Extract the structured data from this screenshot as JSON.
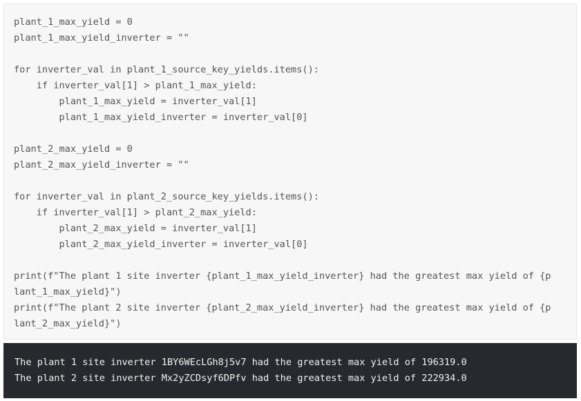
{
  "code_cell": {
    "lines": [
      "plant_1_max_yield = 0",
      "plant_1_max_yield_inverter = \"\"",
      "",
      "for inverter_val in plant_1_source_key_yields.items():",
      "    if inverter_val[1] > plant_1_max_yield:",
      "        plant_1_max_yield = inverter_val[1]",
      "        plant_1_max_yield_inverter = inverter_val[0]",
      "",
      "plant_2_max_yield = 0",
      "plant_2_max_yield_inverter = \"\"",
      "",
      "for inverter_val in plant_2_source_key_yields.items():",
      "    if inverter_val[1] > plant_2_max_yield:",
      "        plant_2_max_yield = inverter_val[1]",
      "        plant_2_max_yield_inverter = inverter_val[0]",
      "",
      "print(f\"The plant 1 site inverter {plant_1_max_yield_inverter} had the greatest max yield of {p",
      "lant_1_max_yield}\")",
      "print(f\"The plant 2 site inverter {plant_2_max_yield_inverter} had the greatest max yield of {p",
      "lant_2_max_yield}\")"
    ]
  },
  "output_cell": {
    "lines": [
      "The plant 1 site inverter 1BY6WEcLGh8j5v7 had the greatest max yield of 196319.0",
      "The plant 2 site inverter Mx2yZCDsyf6DPfv had the greatest max yield of 222934.0"
    ]
  }
}
